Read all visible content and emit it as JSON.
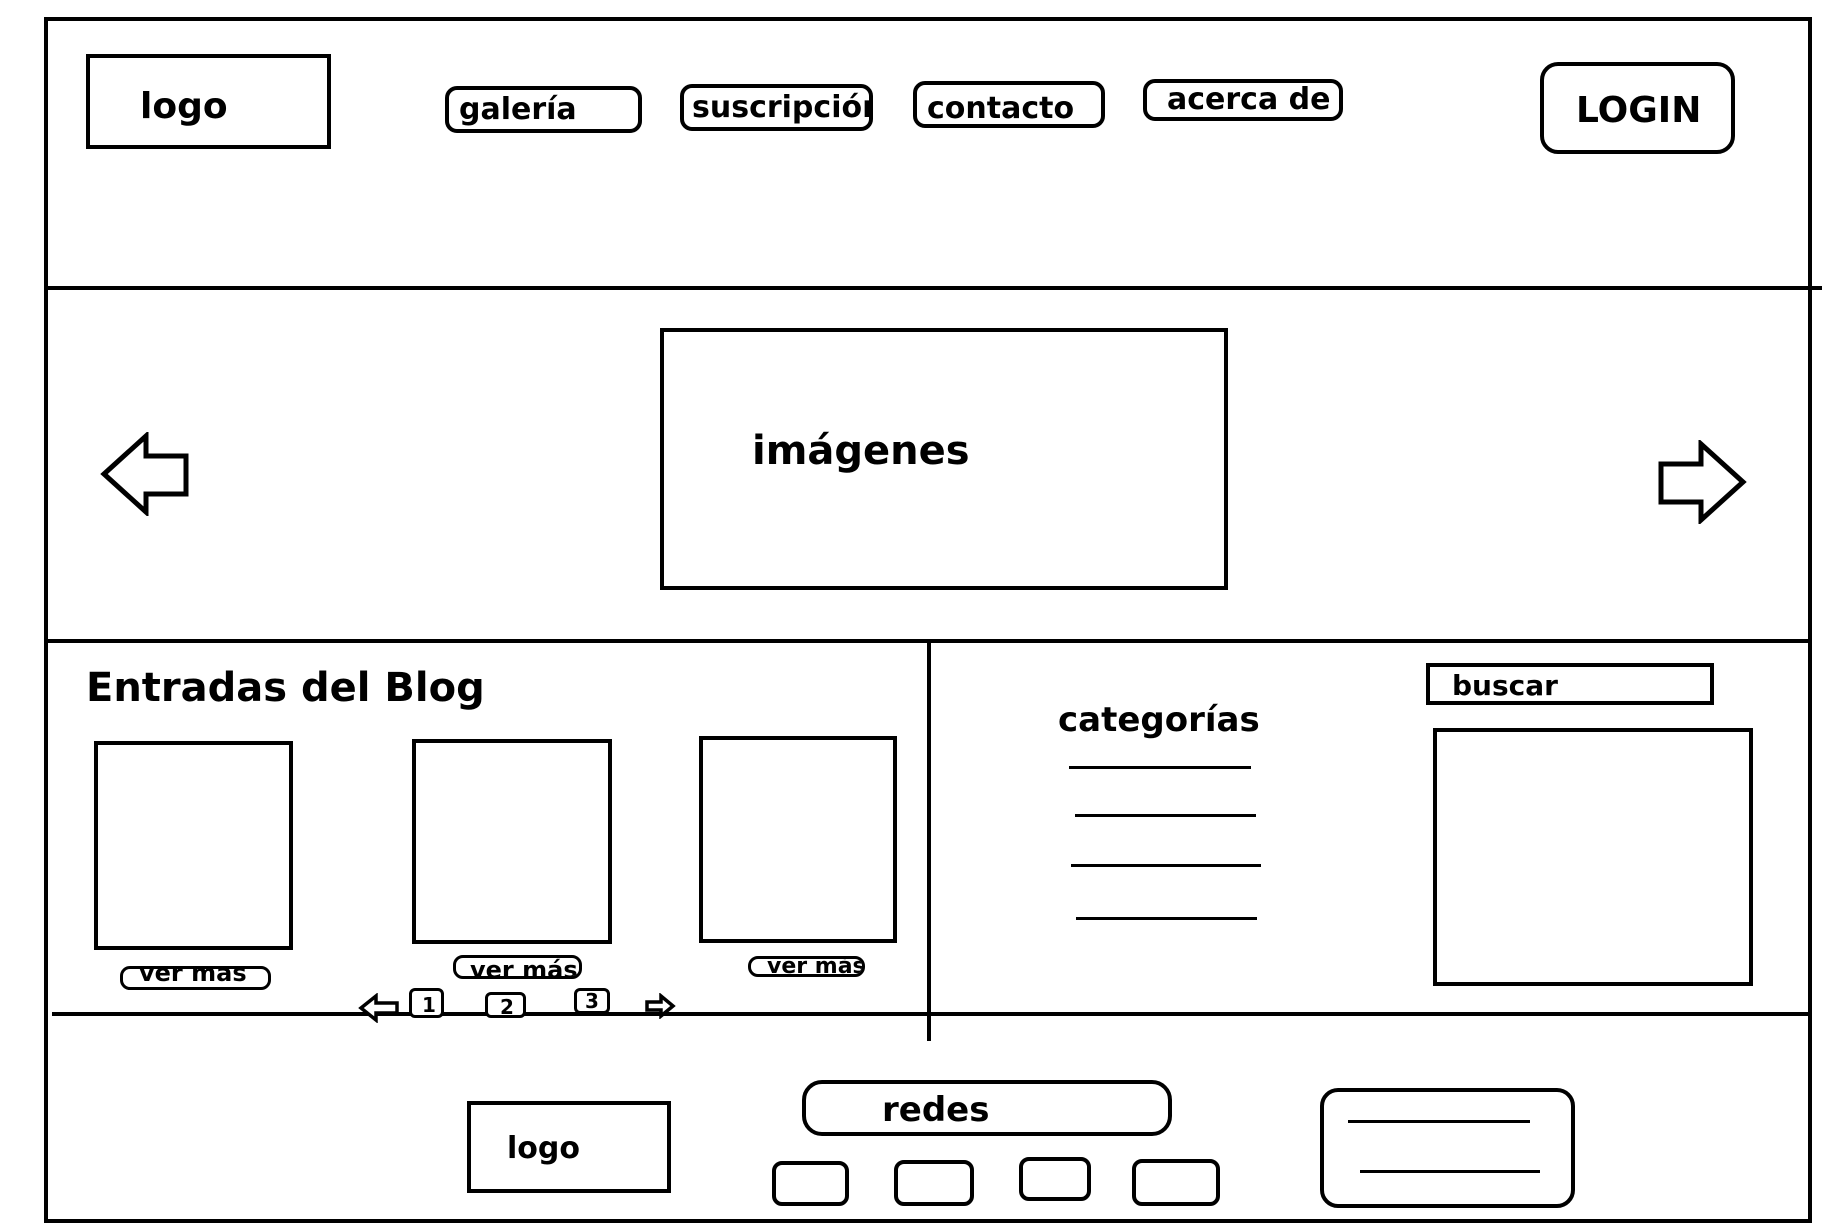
{
  "header": {
    "logo_label": "logo",
    "nav": {
      "galeria": "galería",
      "suscripcion": "suscripción",
      "contacto": "contacto",
      "acerca": "acerca de"
    },
    "login_label": "LOGIN"
  },
  "carousel": {
    "images_label": "imágenes",
    "prev_icon": "left-arrow-icon",
    "next_icon": "right-arrow-icon"
  },
  "blog": {
    "title": "Entradas del Blog",
    "cards": [
      {
        "more_label": "ver más"
      },
      {
        "more_label": "ver más"
      },
      {
        "more_label": "ver más"
      }
    ],
    "pagination": {
      "pages": [
        "1",
        "2",
        "3"
      ],
      "prev_icon": "left-arrow-icon",
      "next_icon": "right-arrow-icon"
    }
  },
  "sidebar": {
    "categories_title": "categorías",
    "search_label": "buscar"
  },
  "footer": {
    "logo_label": "logo",
    "social_label": "redes"
  }
}
